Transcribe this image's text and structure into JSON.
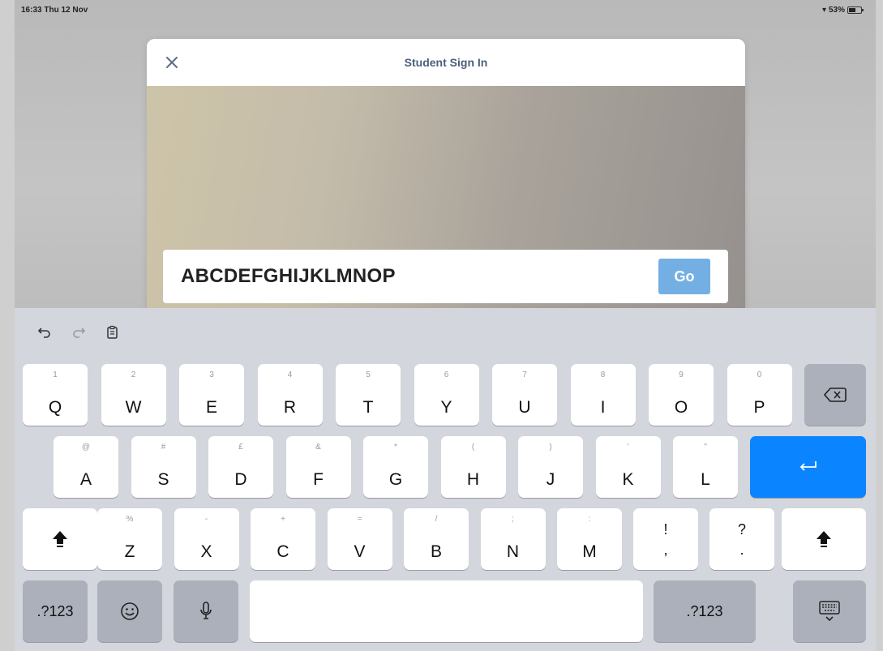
{
  "status_bar": {
    "time": "16:33  Thu 12 Nov",
    "battery": "53%"
  },
  "modal": {
    "title": "Student Sign In",
    "close_icon": "close-icon",
    "code_value": "ABCDEFGHIJKLMNOP",
    "go_label": "Go",
    "accent_color": "#74afe4"
  },
  "keyboard": {
    "toolbar": [
      "undo-icon",
      "redo-icon",
      "paste-icon"
    ],
    "row1": [
      {
        "hint": "1",
        "label": "Q"
      },
      {
        "hint": "2",
        "label": "W"
      },
      {
        "hint": "3",
        "label": "E"
      },
      {
        "hint": "4",
        "label": "R"
      },
      {
        "hint": "5",
        "label": "T"
      },
      {
        "hint": "6",
        "label": "Y"
      },
      {
        "hint": "7",
        "label": "U"
      },
      {
        "hint": "8",
        "label": "I"
      },
      {
        "hint": "9",
        "label": "O"
      },
      {
        "hint": "0",
        "label": "P"
      }
    ],
    "row2": [
      {
        "hint": "@",
        "label": "A"
      },
      {
        "hint": "#",
        "label": "S"
      },
      {
        "hint": "£",
        "label": "D"
      },
      {
        "hint": "&",
        "label": "F"
      },
      {
        "hint": "*",
        "label": "G"
      },
      {
        "hint": "(",
        "label": "H"
      },
      {
        "hint": ")",
        "label": "J"
      },
      {
        "hint": "'",
        "label": "K"
      },
      {
        "hint": "\"",
        "label": "L"
      }
    ],
    "row3": [
      {
        "hint": "%",
        "label": "Z"
      },
      {
        "hint": "-",
        "label": "X"
      },
      {
        "hint": "+",
        "label": "C"
      },
      {
        "hint": "=",
        "label": "V"
      },
      {
        "hint": "/",
        "label": "B"
      },
      {
        "hint": ";",
        "label": "N"
      },
      {
        "hint": ":",
        "label": "M"
      }
    ],
    "punct": [
      {
        "top": "!",
        "bottom": ","
      },
      {
        "top": "?",
        "bottom": "."
      }
    ],
    "numbers_label": ".?123",
    "return_color": "#0a84ff"
  }
}
